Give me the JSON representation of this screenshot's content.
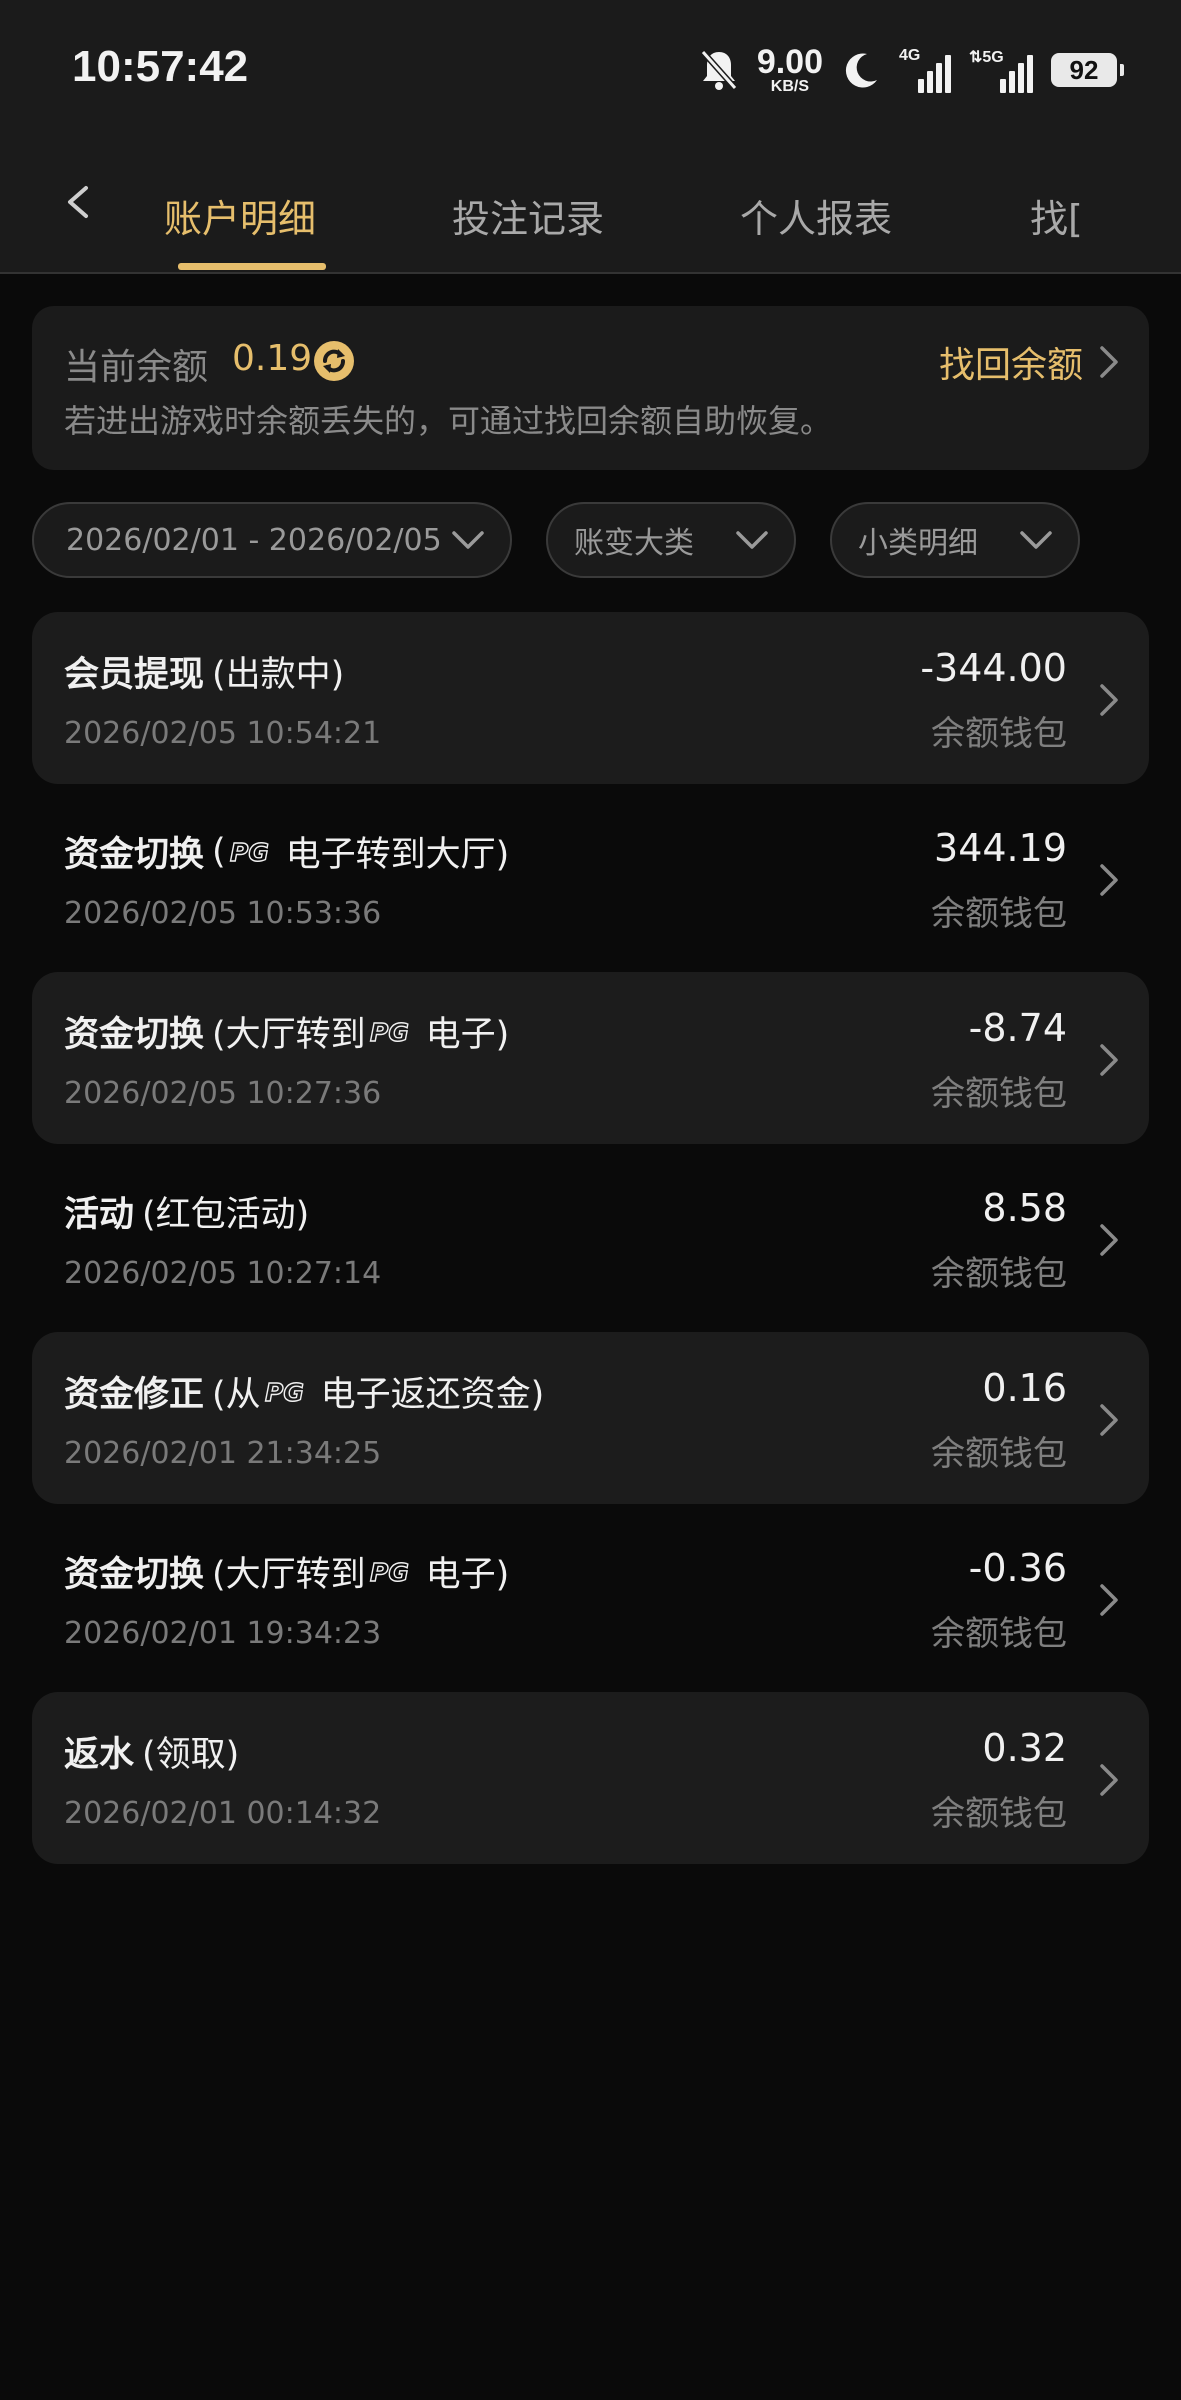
{
  "status_bar": {
    "time": "10:57:42",
    "net_speed_value": "9.00",
    "net_speed_unit": "KB/S",
    "signal1_label": "4G",
    "signal2_label": "5G",
    "battery": "92",
    "icons": [
      "mute-bell-icon",
      "moon-icon",
      "signal-4g-icon",
      "signal-5g-icon",
      "battery-icon"
    ]
  },
  "tabs": [
    {
      "label": "账户明细",
      "active": true
    },
    {
      "label": "投注记录",
      "active": false
    },
    {
      "label": "个人报表",
      "active": false
    },
    {
      "label": "找[",
      "active": false
    }
  ],
  "balance": {
    "label": "当前余额",
    "value": "0.19",
    "recover_label": "找回余额",
    "hint": "若进出游戏时余额丢失的，可通过找回余额自助恢复。"
  },
  "filters": {
    "date_range": "2026/02/01 - 2026/02/05",
    "category": "账变大类",
    "subcategory": "小类明细"
  },
  "records": [
    {
      "title": "会员提现",
      "pre": "(出款中)",
      "post": "",
      "time": "2026/02/05 10:54:21",
      "amount": "-344.00",
      "wallet": "余额钱包"
    },
    {
      "title": "资金切换",
      "pre": "(",
      "post": "电子转到大厅)",
      "time": "2026/02/05 10:53:36",
      "amount": "344.19",
      "wallet": "余额钱包"
    },
    {
      "title": "资金切换",
      "pre": "(大厅转到",
      "post": "电子)",
      "time": "2026/02/05 10:27:36",
      "amount": "-8.74",
      "wallet": "余额钱包"
    },
    {
      "title": "活动",
      "pre": "(红包活动)",
      "post": "",
      "time": "2026/02/05 10:27:14",
      "amount": "8.58",
      "wallet": "余额钱包"
    },
    {
      "title": "资金修正",
      "pre": "(从",
      "post": "电子返还资金)",
      "time": "2026/02/01 21:34:25",
      "amount": "0.16",
      "wallet": "余额钱包"
    },
    {
      "title": "资金切换",
      "pre": "(大厅转到",
      "post": "电子)",
      "time": "2026/02/01 19:34:23",
      "amount": "-0.36",
      "wallet": "余额钱包"
    },
    {
      "title": "返水",
      "pre": "(领取)",
      "post": "",
      "time": "2026/02/01 00:14:32",
      "amount": "0.32",
      "wallet": "余额钱包"
    }
  ],
  "colors": {
    "accent": "#e6be6c",
    "background": "#0a0a0a",
    "card": "#1c1c1c"
  }
}
